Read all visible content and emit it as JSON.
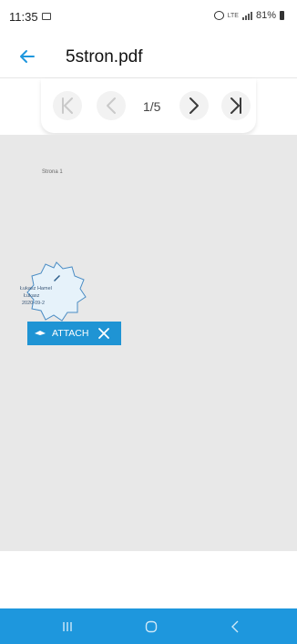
{
  "status_bar": {
    "time": "11:35",
    "network": "LTE",
    "battery": "81%",
    "icons": [
      "photo-icon",
      "alarm-icon",
      "signal-icon",
      "battery-icon"
    ]
  },
  "app_bar": {
    "title": "5stron.pdf",
    "back_icon": "arrow-left-icon"
  },
  "pager": {
    "page_indicator": "1/5",
    "current_page": 1,
    "total_pages": 5,
    "buttons": [
      "first-page-icon",
      "previous-page-icon",
      "next-page-icon",
      "last-page-icon"
    ]
  },
  "document": {
    "page_text": "Strona 1",
    "signature": {
      "line1": "Łukasz Hamel",
      "line2": "Łukasz",
      "line3": "2020-09-2",
      "icon": "pen-icon"
    },
    "attach_bar": {
      "label": "ATTACH",
      "drag_icon": "drag-handle-icon",
      "close_icon": "close-icon"
    }
  },
  "nav_bar": {
    "buttons": [
      "recents-icon",
      "home-icon",
      "back-icon"
    ]
  },
  "colors": {
    "accent": "#1e97dd",
    "attach": "#1f94d4",
    "document_bg": "#e8e8e8",
    "disabled_icon": "#c9c9c9",
    "enabled_icon": "#3a3a3a"
  }
}
